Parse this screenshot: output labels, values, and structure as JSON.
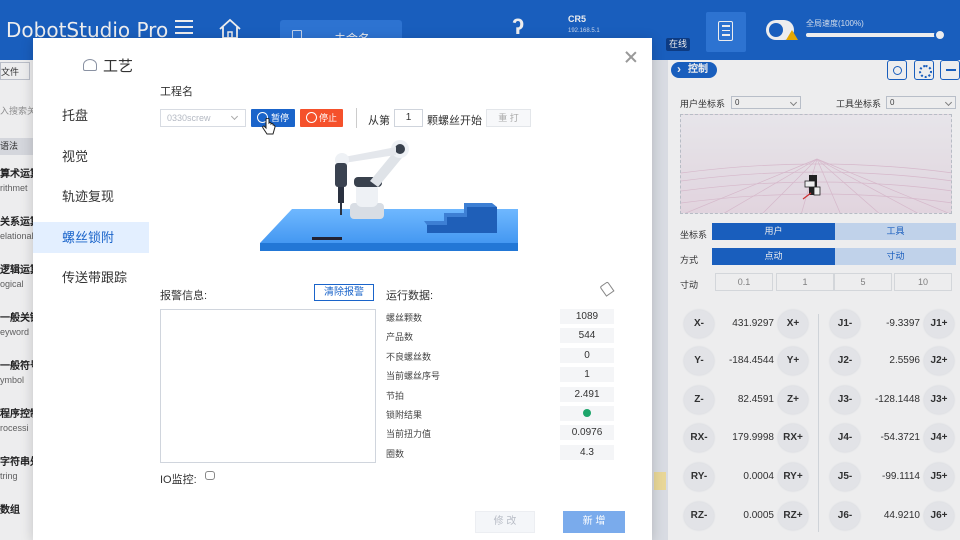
{
  "topbar": {
    "app_title": "DobotStudio Pro",
    "doc_tab": "未命名",
    "robot_name": "CR5",
    "robot_ip": "192.168.5.1",
    "status": "在线",
    "speed_label": "全局速度(100%)",
    "speed_value": 100,
    "accent_color": "#1a64ca"
  },
  "left_panel": {
    "file_button": "文件",
    "search_placeholder": "入搜索关",
    "syntax": "语法",
    "commands": [
      {
        "cn": "算术运算",
        "en": "rithmet"
      },
      {
        "cn": "关系运算",
        "en": "elational"
      },
      {
        "cn": "逻辑运算",
        "en": "ogical"
      },
      {
        "cn": "一般关键",
        "en": "eyword"
      },
      {
        "cn": "一般符号",
        "en": "ymbol"
      },
      {
        "cn": "程序控制",
        "en": "rocessi"
      },
      {
        "cn": "字符串处",
        "en": "tring"
      },
      {
        "cn": "数组",
        "en": ""
      }
    ]
  },
  "right_panel": {
    "control_tab": "控制",
    "user_frame_label": "用户坐标系",
    "user_frame_value": "0",
    "tool_frame_label": "工具坐标系",
    "tool_frame_value": "0",
    "coord_label": "坐标系",
    "coord_options": [
      "用户",
      "工具"
    ],
    "mode_label": "方式",
    "mode_options": [
      "点动",
      "寸动"
    ],
    "step_label": "寸动",
    "step_options": [
      "0.1",
      "1",
      "5",
      "10"
    ],
    "cartesian": [
      {
        "minus": "X-",
        "value": "431.9297",
        "plus": "X+"
      },
      {
        "minus": "Y-",
        "value": "-184.4544",
        "plus": "Y+"
      },
      {
        "minus": "Z-",
        "value": "82.4591",
        "plus": "Z+"
      },
      {
        "minus": "RX-",
        "value": "179.9998",
        "plus": "RX+"
      },
      {
        "minus": "RY-",
        "value": "0.0004",
        "plus": "RY+"
      },
      {
        "minus": "RZ-",
        "value": "0.0005",
        "plus": "RZ+"
      }
    ],
    "joints": [
      {
        "minus": "J1-",
        "value": "-9.3397",
        "plus": "J1+"
      },
      {
        "minus": "J2-",
        "value": "2.5596",
        "plus": "J2+"
      },
      {
        "minus": "J3-",
        "value": "-128.1448",
        "plus": "J3+"
      },
      {
        "minus": "J4-",
        "value": "-54.3721",
        "plus": "J4+"
      },
      {
        "minus": "J5-",
        "value": "-99.1114",
        "plus": "J5+"
      },
      {
        "minus": "J6-",
        "value": "44.9210",
        "plus": "J6+"
      }
    ]
  },
  "modal": {
    "title": "工艺",
    "nav": [
      "托盘",
      "视觉",
      "轨迹复现",
      "螺丝锁附",
      "传送带跟踪"
    ],
    "active_nav": "螺丝锁附",
    "project_label": "工程名",
    "project_value": "0330screw",
    "pause_label": "暂停",
    "stop_label": "停止",
    "from_prefix": "从第",
    "from_value": "1",
    "from_suffix": "颗螺丝开始",
    "rescrew_label": "重 打",
    "alarm_label": "报警信息:",
    "clear_alarm_label": "清除报警",
    "io_label": "IO监控:",
    "run_label": "运行数据:",
    "stats": [
      {
        "name": "螺丝颗数",
        "value": "1089"
      },
      {
        "name": "产品数",
        "value": "544"
      },
      {
        "name": "不良螺丝数",
        "value": "0"
      },
      {
        "name": "当前螺丝序号",
        "value": "1"
      },
      {
        "name": "节拍",
        "value": "2.491"
      },
      {
        "name": "锁附结果",
        "value": ""
      },
      {
        "name": "当前扭力值",
        "value": "0.0976"
      },
      {
        "name": "圈数",
        "value": "4.3"
      }
    ],
    "edit_label": "修 改",
    "add_label": "新 增"
  }
}
